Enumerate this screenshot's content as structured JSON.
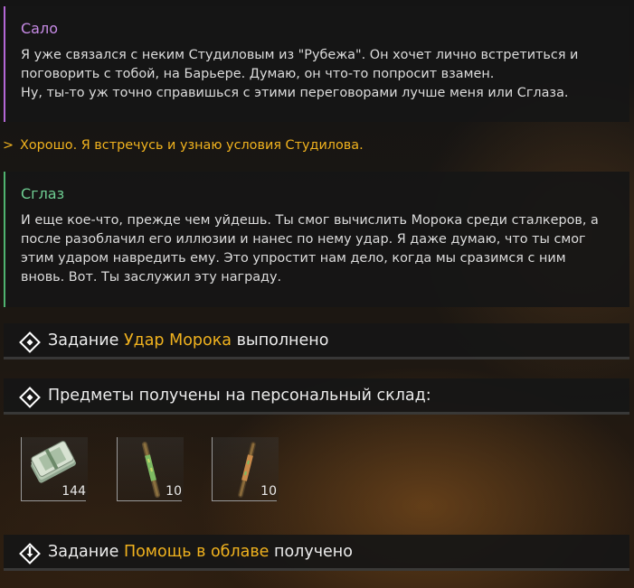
{
  "dialogue": [
    {
      "speaker": "Сало",
      "speaker_color": "#c78be6",
      "accent_color": "#b467d6",
      "text": "Я уже связался с неким Студиловым из \"Рубежа\". Он хочет лично встретиться и\nпоговорить с тобой, на Барьере. Думаю, он что-то попросит взамен.\nНу, ты-то уж точно справишься с этими переговорами лучше меня или Сглаза."
    },
    {
      "speaker": "Сглаз",
      "speaker_color": "#6fcf93",
      "accent_color": "#4fb36f",
      "text": "И еще кое-что, прежде чем уйдешь. Ты смог вычислить Морока среди сталкеров, а\nпосле разоблачил его иллюзии и нанес по нему удар. Я даже думаю, что ты смог\nэтим ударом навредить ему. Это упростит нам дело, когда мы сразимся с ним\nвновь. Вот. Ты заслужил эту награду."
    }
  ],
  "reply": {
    "marker": ">",
    "text": "Хорошо. Я встречусь и узнаю условия Студилова.",
    "color": "#f0b21e"
  },
  "notices": {
    "quest_completed": {
      "prefix": "Задание",
      "quest": "Удар Морока",
      "suffix": "выполнено",
      "icon": "diamond-target-icon"
    },
    "items_received": {
      "text": "Предметы получены на персональный склад:",
      "icon": "diamond-target-icon"
    },
    "quest_received": {
      "prefix": "Задание",
      "quest": "Помощь в облаве",
      "suffix": "получено",
      "icon": "diamond-exclamation-icon"
    }
  },
  "rewards": [
    {
      "icon": "money-bundle-icon",
      "count": "144"
    },
    {
      "icon": "green-wrapped-stick-icon",
      "count": "10"
    },
    {
      "icon": "orange-wrapped-stick-icon",
      "count": "10"
    }
  ],
  "colors": {
    "highlight": "#f0b21e",
    "panel": "#161616"
  }
}
